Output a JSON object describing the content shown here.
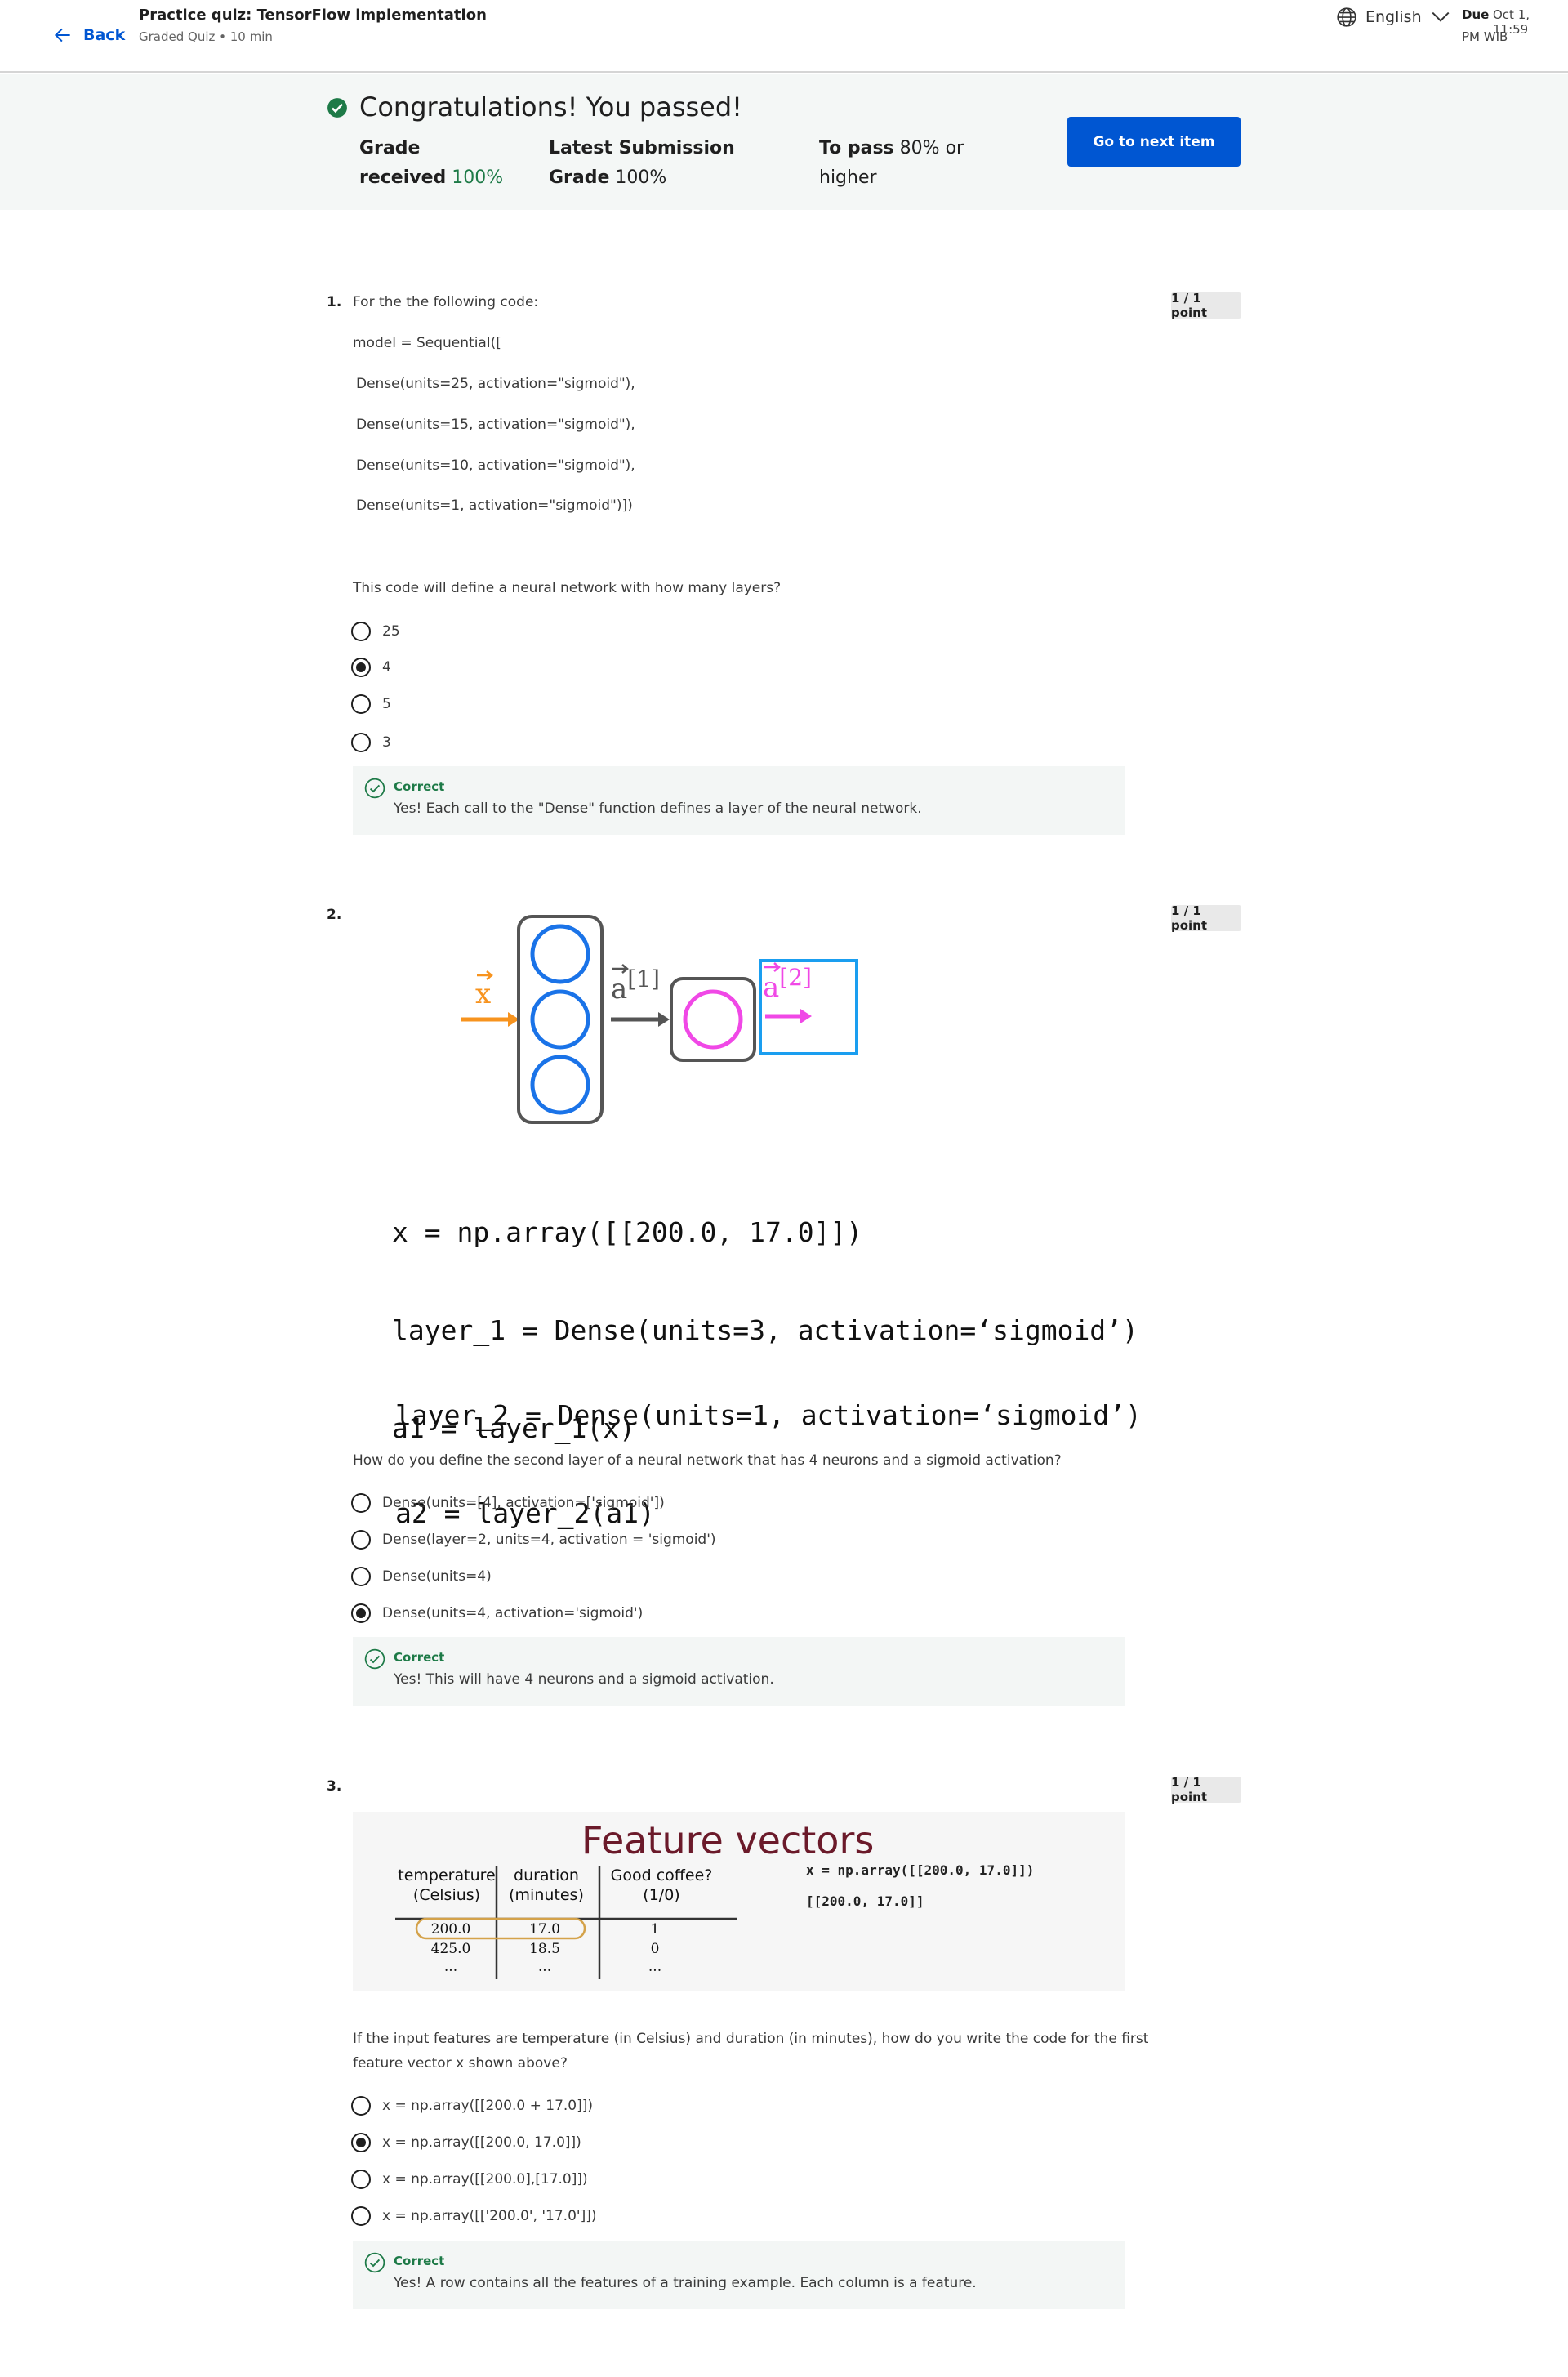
{
  "header": {
    "back_label": "Back",
    "title": "Practice quiz: TensorFlow implementation",
    "meta": "Graded Quiz • 10 min",
    "language": "English",
    "due_label": "Due",
    "due_date": "Oct 1, 11:59",
    "due_time": "PM WIB"
  },
  "banner": {
    "title": "Congratulations! You passed!",
    "grade_label_1": "Grade",
    "grade_label_2": "received",
    "grade_value": "100%",
    "latest_label_1": "Latest Submission",
    "latest_label_2": "Grade",
    "latest_value": "100%",
    "topass_label_1": "To pass",
    "topass_value": "80%",
    "topass_label_2": "or",
    "topass_label_3": "higher",
    "next_button": "Go to next item"
  },
  "questions": [
    {
      "number": "1.",
      "points": "1 / 1 point",
      "intro": "For the the following code:",
      "code": [
        "model = Sequential([",
        " Dense(units=25, activation=\"sigmoid\"),",
        " Dense(units=15, activation=\"sigmoid\"),",
        " Dense(units=10, activation=\"sigmoid\"),",
        " Dense(units=1, activation=\"sigmoid\")])"
      ],
      "prompt": "This code will define a neural network with how many layers?",
      "options": [
        "25",
        "4",
        "5",
        "3"
      ],
      "selected_index": 1,
      "feedback_label": "Correct",
      "feedback_text": "Yes! Each call to the \"Dense\" function defines a layer of the neural network."
    },
    {
      "number": "2.",
      "points": "1 / 1 point",
      "diagram": {
        "x_label": "x",
        "a1_label": "a",
        "a1_sup": "[1]",
        "a2_label": "a",
        "a2_sup": "[2]"
      },
      "code_block_1": [
        "x = np.array([[200.0, 17.0]])",
        "layer_1 = Dense(units=3, activation=‘sigmoid’)",
        "a1 = layer_1(x)"
      ],
      "code_block_2": [
        "layer_2 = Dense(units=1, activation=‘sigmoid’)",
        "a2 = layer_2(a1)"
      ],
      "prompt": "How do you define the second layer of a neural network that has 4 neurons and a sigmoid activation?",
      "options": [
        "Dense(units=[4], activation=['sigmoid'])",
        "Dense(layer=2, units=4, activation = 'sigmoid')",
        "Dense(units=4)",
        "Dense(units=4, activation='sigmoid')"
      ],
      "selected_index": 3,
      "feedback_label": "Correct",
      "feedback_text": "Yes! This will have 4 neurons and a sigmoid activation."
    },
    {
      "number": "3.",
      "points": "1 / 1 point",
      "figure": {
        "title": "Feature vectors",
        "headers": [
          "temperature\n(Celsius)",
          "duration\n(minutes)",
          "Good coffee?\n(1/0)"
        ],
        "rows": [
          [
            "200.0",
            "17.0",
            "1"
          ],
          [
            "425.0",
            "18.5",
            "0"
          ],
          [
            "...",
            "...",
            "..."
          ]
        ],
        "code_1": "x = np.array([[200.0, 17.0]])",
        "code_2": "[[200.0, 17.0]]"
      },
      "prompt_1": "If the input features are temperature (in Celsius) and duration (in minutes), how do you write the code for the first",
      "prompt_2": "feature vector x shown above?",
      "options": [
        "x = np.array([[200.0 + 17.0]])",
        "x = np.array([[200.0, 17.0]])",
        "x = np.array([[200.0],[17.0]])",
        "x = np.array([['200.0', '17.0']])"
      ],
      "selected_index": 1,
      "feedback_label": "Correct",
      "feedback_text": "Yes! A row contains all the features of a training example. Each column is a feature."
    }
  ],
  "colors": {
    "primary": "#0056d2",
    "success": "#1d7a47",
    "banner_bg": "#f4f7f6",
    "diagram_orange": "#f7931e",
    "diagram_blue": "#1a73e8",
    "diagram_magenta": "#f048e6",
    "figure_title": "#6b1a2a"
  }
}
